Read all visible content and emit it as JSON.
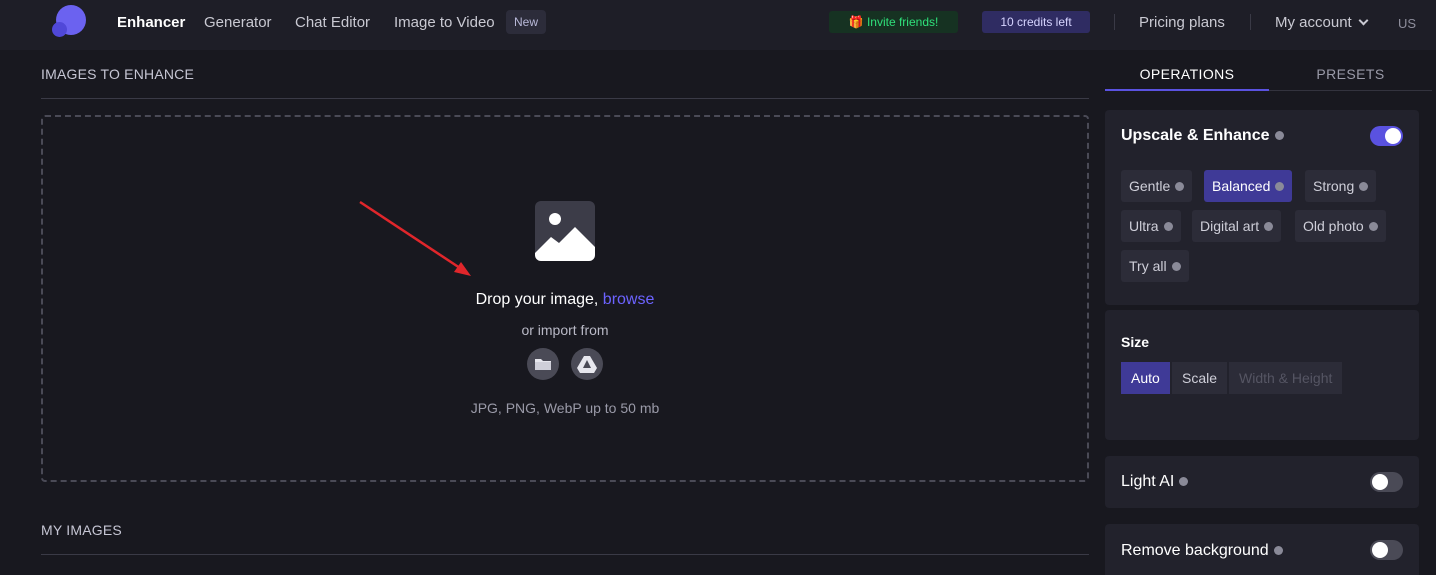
{
  "nav": {
    "items": [
      "Enhancer",
      "Generator",
      "Chat Editor",
      "Image to Video"
    ],
    "new_badge": "New",
    "invite": "Invite friends!",
    "credits": "10 credits left",
    "pricing": "Pricing plans",
    "account": "My account",
    "lang": "US"
  },
  "main": {
    "section_title": "IMAGES TO ENHANCE",
    "drop_text": "Drop your image,",
    "browse": "browse",
    "import_text": "or import from",
    "formats": "JPG, PNG, WebP up to 50 mb",
    "my_images": "MY IMAGES"
  },
  "panel": {
    "tabs": [
      "OPERATIONS",
      "PRESETS"
    ],
    "upscale": {
      "title": "Upscale & Enhance",
      "enabled": true,
      "options": [
        "Gentle",
        "Balanced",
        "Strong",
        "Ultra",
        "Digital art",
        "Old photo",
        "Try all"
      ],
      "selected": "Balanced"
    },
    "size": {
      "label": "Size",
      "options": [
        "Auto",
        "Scale",
        "Width & Height"
      ],
      "selected": "Auto"
    },
    "light_ai": {
      "title": "Light AI",
      "enabled": false
    },
    "remove_bg": {
      "title": "Remove background",
      "enabled": false
    }
  },
  "colors": {
    "accent": "#5a52e0",
    "browse": "#6c63ff",
    "invite_text": "#2fe07a",
    "arrow": "#e0262b"
  }
}
